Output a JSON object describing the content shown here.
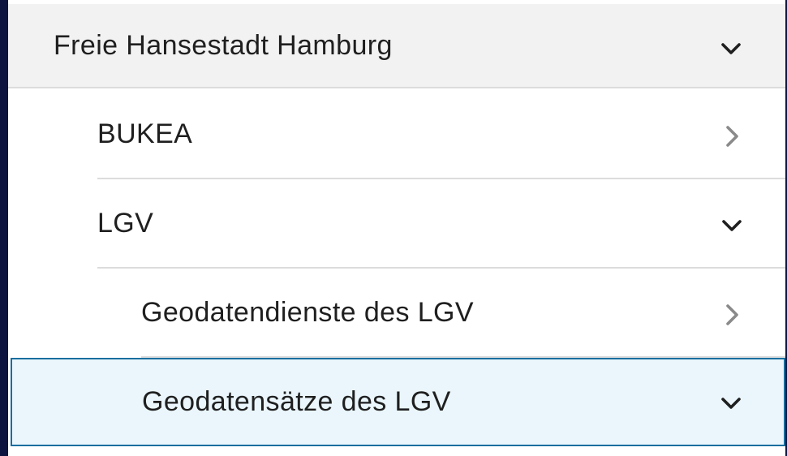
{
  "tree": {
    "items": [
      {
        "label": "Freie Hansestadt Hamburg",
        "icon": "chevron-down-icon",
        "expanded": true
      },
      {
        "label": "BUKEA",
        "icon": "chevron-right-icon",
        "expanded": false
      },
      {
        "label": "LGV",
        "icon": "chevron-down-icon",
        "expanded": true
      },
      {
        "label": "Geodatendienste des LGV",
        "icon": "chevron-right-icon",
        "expanded": false
      },
      {
        "label": "Geodatensätze des LGV",
        "icon": "chevron-down-icon",
        "expanded": true,
        "selected": true
      }
    ]
  },
  "colors": {
    "header_bg": "#f2f2f2",
    "selected_bg": "#eaf6fc",
    "selected_border": "#1a6e9f",
    "chevron_dark": "#1f1f1f",
    "chevron_light": "#8a8a8a",
    "rail": "#0e1440"
  }
}
